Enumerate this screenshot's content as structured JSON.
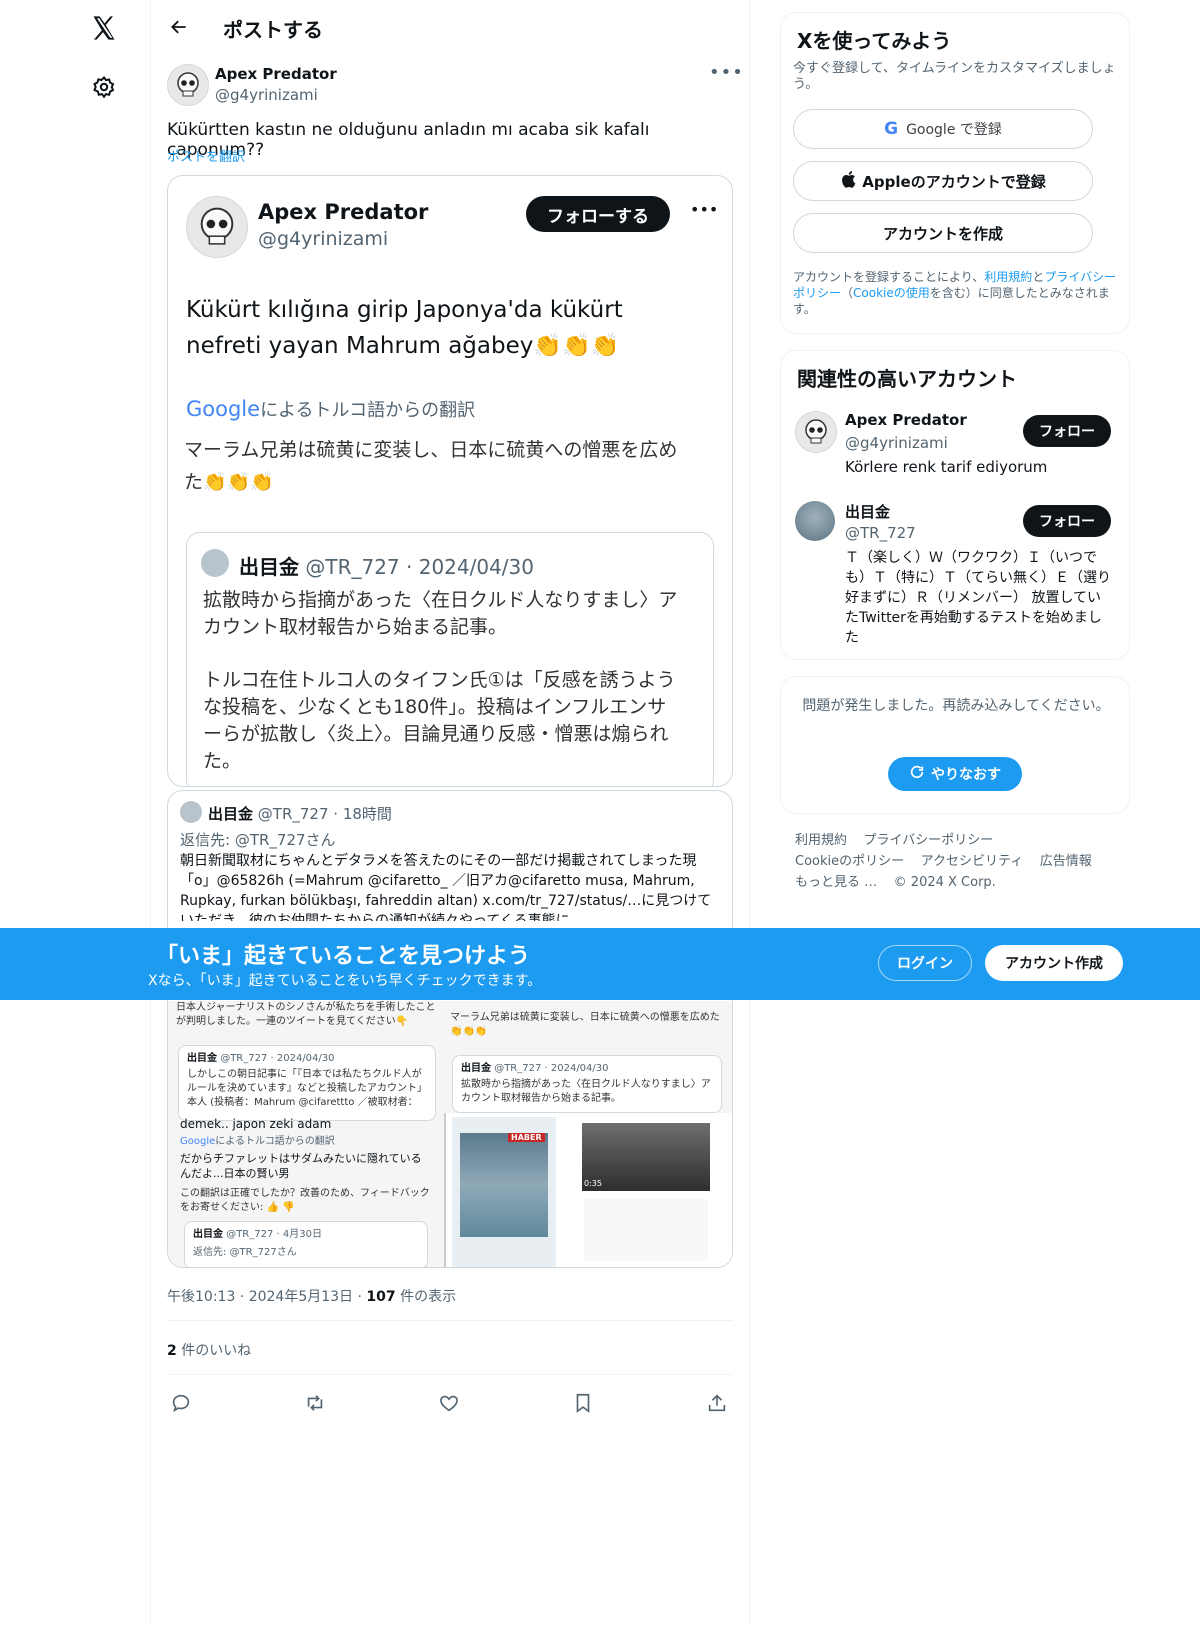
{
  "nav": {
    "logo": "X"
  },
  "header": {
    "title": "ポストする"
  },
  "tweet": {
    "author_name": "Apex Predator",
    "author_handle": "@g4yrinizami",
    "text": "Kükürtten kastın ne olduğunu anladın mı acaba sik kafalı caponum??",
    "translate_link": "ポストを翻訳",
    "timestamp": "午後10:13 · 2024年5月13日 ·",
    "views_count": "107",
    "views_label": "件の表示",
    "likes_count": "2",
    "likes_label": "件のいいね"
  },
  "embedded": {
    "author_name": "Apex Predator",
    "author_handle": "@g4yrinizami",
    "follow_label": "フォローする",
    "text": "Kükürt kılığına girip Japonya'da kükürt nefreti yayan Mahrum ağabey👏👏👏",
    "google_logo": "Google",
    "translation_label": "によるトルコ語からの翻訳",
    "translation": "マーラム兄弟は硫黄に変装し、日本に硫黄への憎悪を広めた👏👏👏",
    "quoted": {
      "name": "出目金",
      "meta": "@TR_727 · 2024/04/30",
      "line1": "拡散時から指摘があった〈在日クルド人なりすまし〉アカウント取材報告から始まる記事。",
      "line2": "トルコ在住トルコ人のタイフン氏①は「反感を誘うような投稿を、少なくとも180件」。投稿はインフルエンサーらが拡散し〈炎上〉。目論見通り反感・憎悪は煽られた。"
    }
  },
  "reply_card": {
    "name": "出目金",
    "meta": "@TR_727 · 18時間",
    "reply_to": "返信先: @TR_727さん",
    "text": "朝日新聞取材にちゃんとデタラメを答えたのにその一部だけ掲載されてしまった現「o」@65826h (=Mahrum @cifaretto_ ／旧アカ@cifaretto musa, Mahrum, Rupkay, furkan bölükbaşı, fahreddin altan) x.com/tr_727/status/…に見つけていただき、彼のお仲間たちからの通知が続々やってくる事態に。"
  },
  "collage": {
    "left_top": "日本人ジャーナリストのシノさんが私たちを手術したことが判明しました。一連のツイートを見てください👇",
    "left_q_name": "出目金",
    "left_q_meta": "@TR_727 · 2024/04/30",
    "left_q_text": "しかしこの朝日記事に「『日本では私たちクルド人がルールを決めています』などと投稿したアカウント」本人 (投稿者：Mahrum @cifarettto ／被取材者：",
    "left_cut": "demek.. japon zeki adam",
    "left_google": "Google",
    "left_trans_label": "によるトルコ語からの翻訳",
    "left_trans": "だからチファレットはサダムみたいに隠れているんだよ...日本の賢い男",
    "left_feedback": "この翻訳は正確でしたか？改善のため、フィードバックをお寄せください: 👍 👎",
    "left_b_name": "出目金",
    "left_b_meta": "@TR_727 · 4月30日",
    "left_b_reply": "返信先: @TR_727さん",
    "right_top": "マーラム兄弟は硫黄に変装し、日本に硫黄への憎悪を広めた👏👏👏",
    "right_q_name": "出目金",
    "right_q_meta": "@TR_727 · 2024/04/30",
    "right_q_text": "拡散時から指摘があった〈在日クルド人なりすまし〉アカウント取材報告から始まる記事。",
    "img1_badge": "HABER",
    "img2_time": "0:35"
  },
  "signup": {
    "title": "Xを使ってみよう",
    "subtitle": "今すぐ登録して、タイムラインをカスタマイズしましょう。",
    "google_btn": "Google で登録",
    "apple_btn": "Appleのアカウントで登録",
    "create_btn": "アカウントを作成",
    "legal_1": "アカウントを登録することにより、",
    "legal_terms": "利用規約",
    "legal_and": "と",
    "legal_privacy": "プライバシーポリシー",
    "legal_2": "（",
    "legal_cookie": "Cookieの使用",
    "legal_3": "を含む）に同意したとみなされます。"
  },
  "related": {
    "title": "関連性の高いアカウント",
    "accounts": [
      {
        "name": "Apex Predator",
        "handle": "@g4yrinizami",
        "bio": "Körlere renk tarif ediyorum",
        "follow": "フォロー"
      },
      {
        "name": "出目金",
        "handle": "@TR_727",
        "bio": "Ｔ（楽しく）Ｗ（ワクワク）Ｉ（いつでも）Ｔ（特に）Ｔ（てらい無く）Ｅ（選り好まずに）Ｒ（リメンバー） 放置していたTwitterを再始動するテストを始めました",
        "follow": "フォロー"
      }
    ]
  },
  "error_box": {
    "message": "問題が発生しました。再読み込みしてください。",
    "retry": "やりなおす"
  },
  "footer": {
    "links": [
      "利用規約",
      "プライバシーポリシー",
      "Cookieのポリシー",
      "アクセシビリティ",
      "広告情報",
      "もっと見る …"
    ],
    "copyright": "© 2024 X Corp."
  },
  "banner": {
    "title": "「いま」起きていることを見つけよう",
    "subtitle": "Xなら、「いま」起きていることをいち早くチェックできます。",
    "login": "ログイン",
    "signup": "アカウント作成"
  }
}
